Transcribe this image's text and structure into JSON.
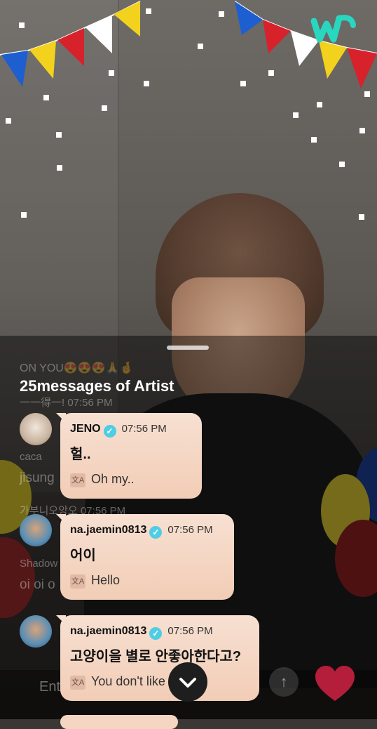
{
  "logo": {
    "icon": "weverse-w-icon",
    "color": "#29d6c0"
  },
  "background_chat": {
    "lines": [
      {
        "text": "ON YOU😍😍😍🙏🤞"
      },
      {
        "text": "一一得一!   07:56 PM"
      },
      {
        "text": "caca"
      },
      {
        "text": "jisung"
      },
      {
        "text": "가부니오앙오   07:56 PM"
      },
      {
        "text": "Shadow"
      },
      {
        "text": "oi oi o"
      }
    ]
  },
  "input": {
    "placeholder": "Ent",
    "send_icon": "arrow-up-icon",
    "heart_icon": "heart-icon"
  },
  "sheet": {
    "title": "25messages of Artist",
    "messages": [
      {
        "name": "JENO",
        "time": "07:56 PM",
        "text": "헐..",
        "translation": "Oh my..",
        "translate_icon": "文A"
      },
      {
        "name": "na.jaemin0813",
        "time": "07:56 PM",
        "text": "어이",
        "translation": "Hello",
        "translate_icon": "文A"
      },
      {
        "name": "na.jaemin0813",
        "time": "07:56 PM",
        "text": "고양이을 별로 안좋아한다고?",
        "translation": "You don't like",
        "translate_icon": "文A"
      }
    ],
    "verified_icon": "verified-check-icon",
    "scroll_down_icon": "chevron-down-icon"
  },
  "colors": {
    "bubble": "#f4d6c3",
    "verified": "#4fcde4",
    "heart": "#b51e3a"
  }
}
